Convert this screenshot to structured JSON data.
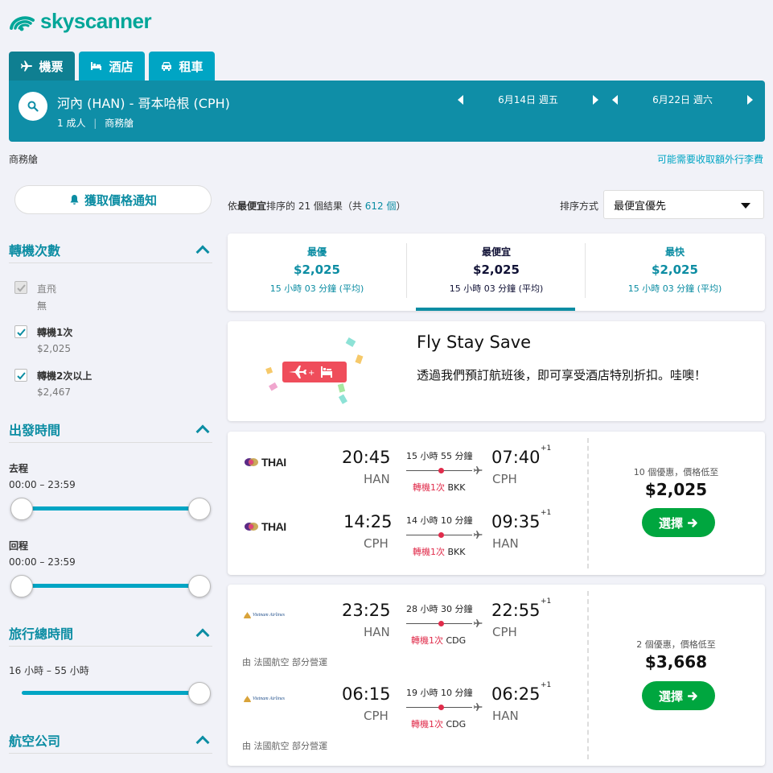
{
  "brand": {
    "name": "skyscanner"
  },
  "tabs": [
    {
      "label": "機票",
      "icon": "plane-icon"
    },
    {
      "label": "酒店",
      "icon": "bed-icon"
    },
    {
      "label": "租車",
      "icon": "car-icon"
    }
  ],
  "search": {
    "route": "河內 (HAN) - 哥本哈根 (CPH)",
    "passengers": "1 成人",
    "cabin": "商務艙",
    "depart_date": "6月14日 週五",
    "return_date": "6月22日 週六"
  },
  "subheader": {
    "cabin": "商務艙",
    "baggage_link": "可能需要收取額外行李費"
  },
  "sidebar": {
    "alert_button": "獲取價格通知",
    "stops": {
      "title": "轉機次數",
      "options": [
        {
          "label": "直飛",
          "sub": "無",
          "checked": true,
          "disabled": true
        },
        {
          "label": "轉機1次",
          "sub": "$2,025",
          "checked": true,
          "disabled": false
        },
        {
          "label": "轉機2次以上",
          "sub": "$2,467",
          "checked": true,
          "disabled": false
        }
      ]
    },
    "times": {
      "title": "出發時間",
      "outbound_label": "去程",
      "outbound_range": "00:00 – 23:59",
      "return_label": "回程",
      "return_range": "00:00 – 23:59"
    },
    "duration": {
      "title": "旅行總時間",
      "range": "16 小時 – 55 小時"
    },
    "airlines": {
      "title": "航空公司"
    }
  },
  "results": {
    "prefix": "依",
    "sort_name": "最便宜",
    "middle": "排序的 21 個結果（共 ",
    "total": "612 個",
    "suffix": "）",
    "sort_label": "排序方式",
    "sort_value": "最便宜優先"
  },
  "sort_tabs": [
    {
      "name": "最優",
      "price": "$2,025",
      "duration": "15 小時 03 分鐘 (平均)"
    },
    {
      "name": "最便宜",
      "price": "$2,025",
      "duration": "15 小時 03 分鐘 (平均)"
    },
    {
      "name": "最快",
      "price": "$2,025",
      "duration": "15 小時 03 分鐘 (平均)"
    }
  ],
  "promo": {
    "title": "Fly Stay Save",
    "text": "透過我們預訂航班後，即可享受酒店特別折扣。哇噢！"
  },
  "flights": [
    {
      "airline": "THAI",
      "deals": "10 個優惠，價格低至",
      "price": "$2,025",
      "select": "選擇",
      "legs": [
        {
          "dep_time": "20:45",
          "dep": "HAN",
          "arr_time": "07:40",
          "arr": "CPH",
          "plus": "+1",
          "duration": "15 小時 55 分鐘",
          "stops": "轉機1次",
          "via": "BKK"
        },
        {
          "dep_time": "14:25",
          "dep": "CPH",
          "arr_time": "09:35",
          "arr": "HAN",
          "plus": "+1",
          "duration": "14 小時 10 分鐘",
          "stops": "轉機1次",
          "via": "BKK"
        }
      ]
    },
    {
      "airline": "Vietnam Airlines",
      "deals": "2 個優惠，價格低至",
      "price": "$3,668",
      "select": "選擇",
      "operated": "由 法國航空 部分營運",
      "legs": [
        {
          "dep_time": "23:25",
          "dep": "HAN",
          "arr_time": "22:55",
          "arr": "CPH",
          "plus": "+1",
          "duration": "28 小時 30 分鐘",
          "stops": "轉機1次",
          "via": "CDG"
        },
        {
          "dep_time": "06:15",
          "dep": "CPH",
          "arr_time": "06:25",
          "arr": "HAN",
          "plus": "+1",
          "duration": "19 小時 10 分鐘",
          "stops": "轉機1次",
          "via": "CDG"
        }
      ]
    }
  ]
}
